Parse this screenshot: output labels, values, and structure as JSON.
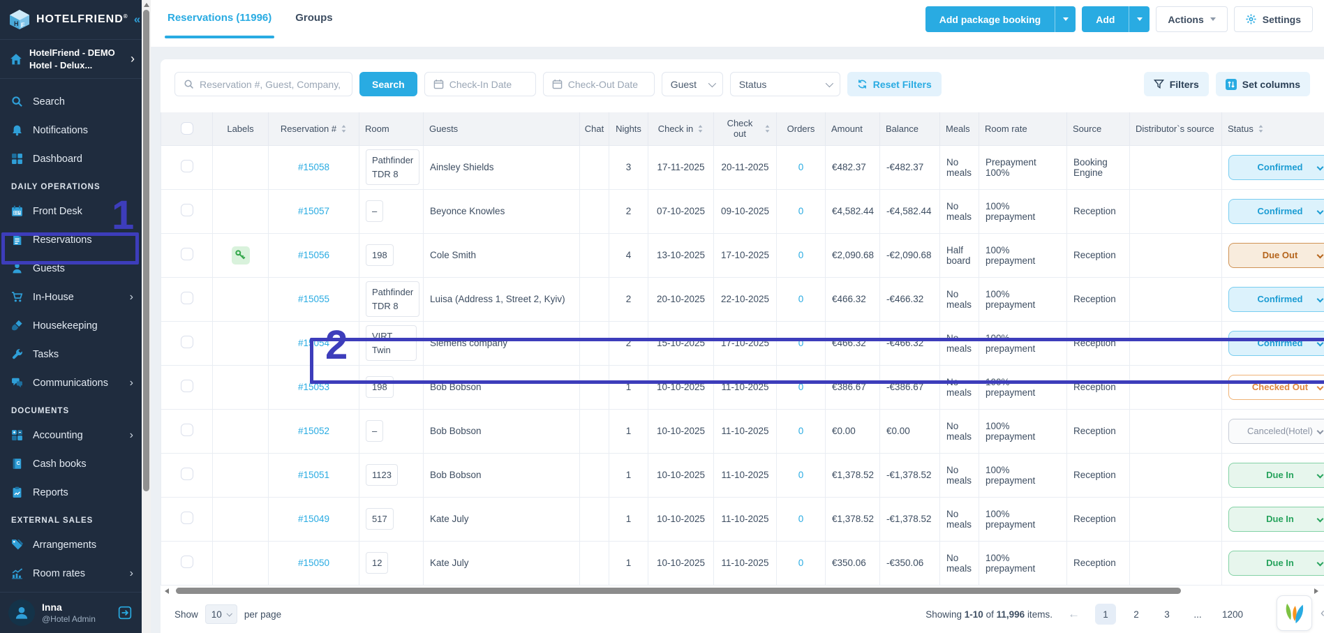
{
  "colors": {
    "brand_blue": "#29abe2",
    "sidebar_bg": "#1f2c3e",
    "annotation_purple": "#3d3dbb",
    "orders_teal": "#26b7cd",
    "status_confirmed_text": "#1b9cd3",
    "status_due_out_text": "#b5651d",
    "status_checked_out_text": "#e0873d",
    "status_canceled_text": "#8a93a3",
    "status_due_in_text": "#27a35d"
  },
  "annotations": {
    "step_1": "1",
    "step_2": "2"
  },
  "sidebar": {
    "logo": {
      "text": "HOTELFRIEND",
      "reg": "®",
      "collapse_icon": "«"
    },
    "hotel": {
      "line1": "HotelFriend - DEMO",
      "line2": "Hotel - Delux...",
      "arrow": "›"
    },
    "menu": [
      {
        "type": "item",
        "icon": "search-icon",
        "label": "Search"
      },
      {
        "type": "item",
        "icon": "bell-icon",
        "label": "Notifications"
      },
      {
        "type": "item",
        "icon": "dashboard-icon",
        "label": "Dashboard"
      },
      {
        "type": "section",
        "label": "DAILY OPERATIONS"
      },
      {
        "type": "item",
        "icon": "calendar-icon",
        "label": "Front Desk"
      },
      {
        "type": "item",
        "icon": "document-icon",
        "label": "Reservations",
        "active": true
      },
      {
        "type": "item",
        "icon": "person-icon",
        "label": "Guests"
      },
      {
        "type": "item",
        "icon": "cart-icon",
        "label": "In-House",
        "arrow": true
      },
      {
        "type": "item",
        "icon": "broom-icon",
        "label": "Housekeeping"
      },
      {
        "type": "item",
        "icon": "wrench-icon",
        "label": "Tasks"
      },
      {
        "type": "item",
        "icon": "chat-icon",
        "label": "Communications",
        "arrow": true
      },
      {
        "type": "section",
        "label": "DOCUMENTS"
      },
      {
        "type": "item",
        "icon": "calculator-icon",
        "label": "Accounting",
        "arrow": true
      },
      {
        "type": "item",
        "icon": "book-icon",
        "label": "Cash books"
      },
      {
        "type": "item",
        "icon": "report-icon",
        "label": "Reports"
      },
      {
        "type": "section",
        "label": "EXTERNAL SALES"
      },
      {
        "type": "item",
        "icon": "tags-icon",
        "label": "Arrangements"
      },
      {
        "type": "item",
        "icon": "chart-icon",
        "label": "Room rates",
        "arrow": true
      }
    ],
    "user": {
      "name": "Inna",
      "role": "@Hotel Admin"
    }
  },
  "header": {
    "tabs": [
      {
        "label": "Reservations (11996)",
        "active": true
      },
      {
        "label": "Groups",
        "active": false
      }
    ],
    "add_package_label": "Add package booking",
    "add_label": "Add",
    "actions_label": "Actions",
    "settings_label": "Settings"
  },
  "filters": {
    "search_placeholder": "Reservation #, Guest, Company, PIN, ID",
    "search_button": "Search",
    "checkin_placeholder": "Check-In Date",
    "checkout_placeholder": "Check-Out Date",
    "guest_label": "Guest",
    "status_label": "Status",
    "reset_label": "Reset Filters",
    "filters_label": "Filters",
    "set_columns_label": "Set columns"
  },
  "table": {
    "columns": [
      {
        "key": "select",
        "label": "",
        "sortable": false,
        "align": "center"
      },
      {
        "key": "labels",
        "label": "Labels",
        "sortable": false,
        "align": "center"
      },
      {
        "key": "reservation",
        "label": "Reservation #",
        "sortable": true,
        "align": "center"
      },
      {
        "key": "room",
        "label": "Room",
        "sortable": false,
        "align": "left"
      },
      {
        "key": "guests",
        "label": "Guests",
        "sortable": false,
        "align": "left"
      },
      {
        "key": "chat",
        "label": "Chat",
        "sortable": false,
        "align": "center"
      },
      {
        "key": "nights",
        "label": "Nights",
        "sortable": false,
        "align": "center"
      },
      {
        "key": "checkin",
        "label": "Check in",
        "sortable": true,
        "align": "center"
      },
      {
        "key": "checkout",
        "label": "Check out",
        "sortable": true,
        "align": "center"
      },
      {
        "key": "orders",
        "label": "Orders",
        "sortable": false,
        "align": "center"
      },
      {
        "key": "amount",
        "label": "Amount",
        "sortable": false,
        "align": "left"
      },
      {
        "key": "balance",
        "label": "Balance",
        "sortable": false,
        "align": "left"
      },
      {
        "key": "meals",
        "label": "Meals",
        "sortable": false,
        "align": "left"
      },
      {
        "key": "room_rate",
        "label": "Room rate",
        "sortable": false,
        "align": "left"
      },
      {
        "key": "source",
        "label": "Source",
        "sortable": false,
        "align": "left"
      },
      {
        "key": "distributor",
        "label": "Distributor`s source",
        "sortable": false,
        "align": "left"
      },
      {
        "key": "status",
        "label": "Status",
        "sortable": true,
        "align": "left"
      }
    ],
    "rows": [
      {
        "id": "#15058",
        "label": "",
        "room": "Pathfinder TDR 8",
        "guests": "Ainsley Shields",
        "chat": "",
        "nights": "3",
        "checkin": "17-11-2025",
        "checkout": "20-11-2025",
        "orders": "0",
        "amount": "€482.37",
        "balance": "-€482.37",
        "meals": "No meals",
        "room_rate": "Prepayment 100%",
        "source": "Booking Engine",
        "distributor": "",
        "status": "Confirmed",
        "status_type": "confirmed",
        "highlighted": false
      },
      {
        "id": "#15057",
        "label": "",
        "room": "–",
        "guests": "Beyonce Knowles",
        "chat": "",
        "nights": "2",
        "checkin": "07-10-2025",
        "checkout": "09-10-2025",
        "orders": "0",
        "amount": "€4,582.44",
        "balance": "-€4,582.44",
        "meals": "No meals",
        "room_rate": "100% prepayment",
        "source": "Reception",
        "distributor": "",
        "status": "Confirmed",
        "status_type": "confirmed",
        "highlighted": false
      },
      {
        "id": "#15056",
        "label": "key",
        "room": "198",
        "guests": "Cole Smith",
        "chat": "",
        "nights": "4",
        "checkin": "13-10-2025",
        "checkout": "17-10-2025",
        "orders": "0",
        "amount": "€2,090.68",
        "balance": "-€2,090.68",
        "meals": "Half board",
        "room_rate": "100% prepayment",
        "source": "Reception",
        "distributor": "",
        "status": "Due Out",
        "status_type": "due-out",
        "highlighted": true
      },
      {
        "id": "#15055",
        "label": "",
        "room": "Pathfinder TDR 8",
        "guests": "Luisa (Address 1, Street 2, Kyiv)",
        "chat": "",
        "nights": "2",
        "checkin": "20-10-2025",
        "checkout": "22-10-2025",
        "orders": "0",
        "amount": "€466.32",
        "balance": "-€466.32",
        "meals": "No meals",
        "room_rate": "100% prepayment",
        "source": "Reception",
        "distributor": "",
        "status": "Confirmed",
        "status_type": "confirmed",
        "highlighted": false
      },
      {
        "id": "#15054",
        "label": "",
        "room": "VIRT, Twin",
        "guests": "Siemens company",
        "chat": "",
        "nights": "2",
        "checkin": "15-10-2025",
        "checkout": "17-10-2025",
        "orders": "0",
        "amount": "€466.32",
        "balance": "-€466.32",
        "meals": "No meals",
        "room_rate": "100% prepayment",
        "source": "Reception",
        "distributor": "",
        "status": "Confirmed",
        "status_type": "confirmed",
        "highlighted": false
      },
      {
        "id": "#15053",
        "label": "",
        "room": "198",
        "guests": "Bob Bobson",
        "chat": "",
        "nights": "1",
        "checkin": "10-10-2025",
        "checkout": "11-10-2025",
        "orders": "0",
        "amount": "€386.67",
        "balance": "-€386.67",
        "meals": "No meals",
        "room_rate": "100% prepayment",
        "source": "Reception",
        "distributor": "",
        "status": "Checked Out",
        "status_type": "checked-out",
        "highlighted": false
      },
      {
        "id": "#15052",
        "label": "",
        "room": "–",
        "guests": "Bob Bobson",
        "chat": "",
        "nights": "1",
        "checkin": "10-10-2025",
        "checkout": "11-10-2025",
        "orders": "0",
        "amount": "€0.00",
        "balance": "€0.00",
        "meals": "No meals",
        "room_rate": "100% prepayment",
        "source": "Reception",
        "distributor": "",
        "status": "Canceled(Hotel)",
        "status_type": "canceled",
        "highlighted": false
      },
      {
        "id": "#15051",
        "label": "",
        "room": "1123",
        "guests": "Bob Bobson",
        "chat": "",
        "nights": "1",
        "checkin": "10-10-2025",
        "checkout": "11-10-2025",
        "orders": "0",
        "amount": "€1,378.52",
        "balance": "-€1,378.52",
        "meals": "No meals",
        "room_rate": "100% prepayment",
        "source": "Reception",
        "distributor": "",
        "status": "Due In",
        "status_type": "due-in",
        "highlighted": false
      },
      {
        "id": "#15049",
        "label": "",
        "room": "517",
        "guests": "Kate July",
        "chat": "",
        "nights": "1",
        "checkin": "10-10-2025",
        "checkout": "11-10-2025",
        "orders": "0",
        "amount": "€1,378.52",
        "balance": "-€1,378.52",
        "meals": "No meals",
        "room_rate": "100% prepayment",
        "source": "Reception",
        "distributor": "",
        "status": "Due In",
        "status_type": "due-in",
        "highlighted": false
      },
      {
        "id": "#15050",
        "label": "",
        "room": "12",
        "guests": "Kate July",
        "chat": "",
        "nights": "1",
        "checkin": "10-10-2025",
        "checkout": "11-10-2025",
        "orders": "0",
        "amount": "€350.06",
        "balance": "-€350.06",
        "meals": "No meals",
        "room_rate": "100% prepayment",
        "source": "Reception",
        "distributor": "",
        "status": "Due In",
        "status_type": "due-in",
        "highlighted": false
      }
    ]
  },
  "pagination": {
    "show_label": "Show",
    "page_size": "10",
    "per_page_label": "per page",
    "showing_prefix": "Showing",
    "range": "1-10",
    "of_label": "of",
    "total": "11,996",
    "items_label": "items.",
    "prev_icon": "←",
    "pages": [
      "1",
      "2",
      "3",
      "...",
      "1200"
    ],
    "active_page": "1"
  }
}
